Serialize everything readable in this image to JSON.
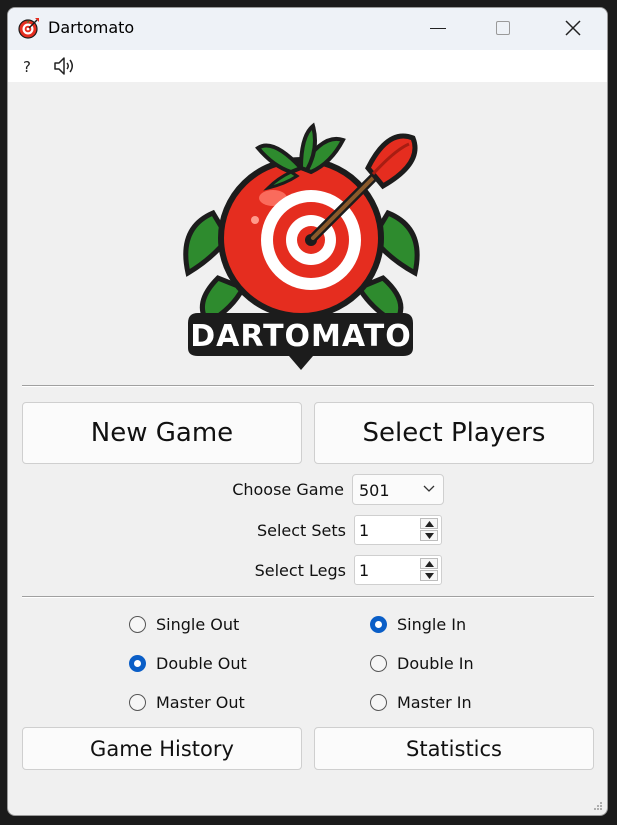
{
  "window": {
    "title": "Dartomato",
    "colors": {
      "accent": "#0a5ec7",
      "logo_red": "#e52d1f",
      "logo_green": "#2e8b2e",
      "logo_dark": "#1c1c1c"
    }
  },
  "menubar": {
    "help_label": "?",
    "sound_icon": "speaker-icon"
  },
  "logo": {
    "text": "DARTOMATO"
  },
  "buttons": {
    "new_game": "New Game",
    "select_players": "Select Players",
    "game_history": "Game History",
    "statistics": "Statistics"
  },
  "settings": {
    "choose_game_label": "Choose Game",
    "choose_game_value": "501",
    "select_sets_label": "Select Sets",
    "select_sets_value": "1",
    "select_legs_label": "Select Legs",
    "select_legs_value": "1"
  },
  "out_options": [
    {
      "label": "Single Out",
      "checked": false
    },
    {
      "label": "Double Out",
      "checked": true
    },
    {
      "label": "Master Out",
      "checked": false
    }
  ],
  "in_options": [
    {
      "label": "Single In",
      "checked": true
    },
    {
      "label": "Double In",
      "checked": false
    },
    {
      "label": "Master In",
      "checked": false
    }
  ]
}
